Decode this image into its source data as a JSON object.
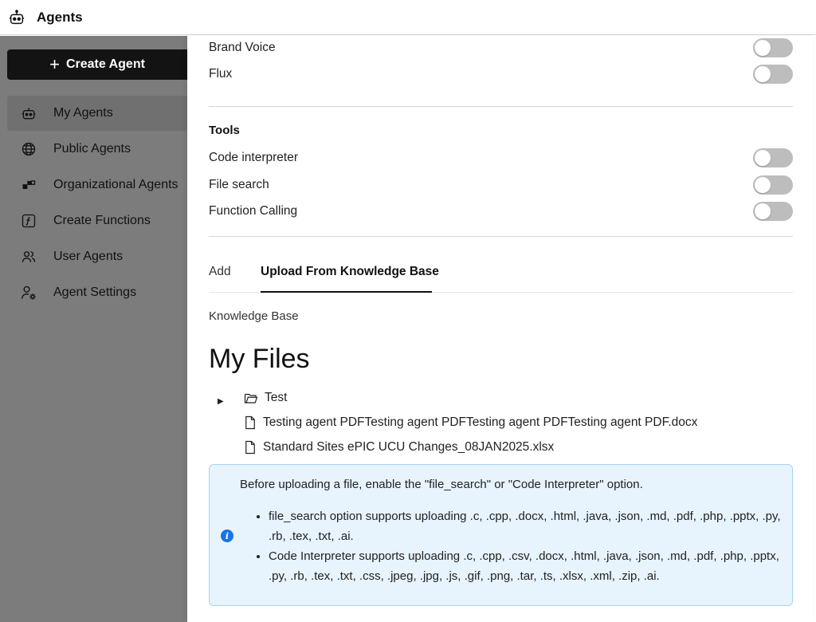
{
  "app": {
    "title": "Agents",
    "icon": "robot-icon"
  },
  "sidebar": {
    "create_label": "Create Agent",
    "items": [
      {
        "label": "My Agents",
        "icon": "robot-icon",
        "active": true
      },
      {
        "label": "Public Agents",
        "icon": "globe-icon",
        "active": false
      },
      {
        "label": "Organizational Agents",
        "icon": "org-blocks-icon",
        "active": false
      },
      {
        "label": "Create Functions",
        "icon": "function-icon",
        "active": false
      },
      {
        "label": "User Agents",
        "icon": "users-icon",
        "active": false
      },
      {
        "label": "Agent Settings",
        "icon": "user-gear-icon",
        "active": false
      }
    ]
  },
  "panel": {
    "integrations": [
      {
        "label": "Brand Voice",
        "enabled": false
      },
      {
        "label": "Flux",
        "enabled": false
      }
    ],
    "tools_title": "Tools",
    "tools": [
      {
        "label": "Code interpreter",
        "enabled": false
      },
      {
        "label": "File search",
        "enabled": false
      },
      {
        "label": "Function Calling",
        "enabled": false
      }
    ],
    "tabs": [
      {
        "label": "Add",
        "active": false
      },
      {
        "label": "Upload From Knowledge Base",
        "active": true
      }
    ],
    "kb_label": "Knowledge Base",
    "files_title": "My Files",
    "tree": {
      "folder": "Test",
      "files": [
        "Testing agent PDFTesting agent PDFTesting agent PDFTesting agent PDF.docx",
        "Standard Sites ePIC UCU Changes_08JAN2025.xlsx"
      ]
    },
    "info": {
      "intro": "Before uploading a file, enable the \"file_search\" or \"Code Interpreter\" option.",
      "bullets": [
        "file_search option supports uploading .c, .cpp, .docx, .html, .java, .json, .md, .pdf, .php, .pptx, .py, .rb, .tex, .txt, .ai.",
        "Code Interpreter supports uploading .c, .cpp, .csv, .docx, .html, .java, .json, .md, .pdf, .php, .pptx, .py, .rb, .tex, .txt, .css, .jpeg, .jpg, .js, .gif, .png, .tar, .ts, .xlsx, .xml, .zip, .ai."
      ]
    }
  }
}
